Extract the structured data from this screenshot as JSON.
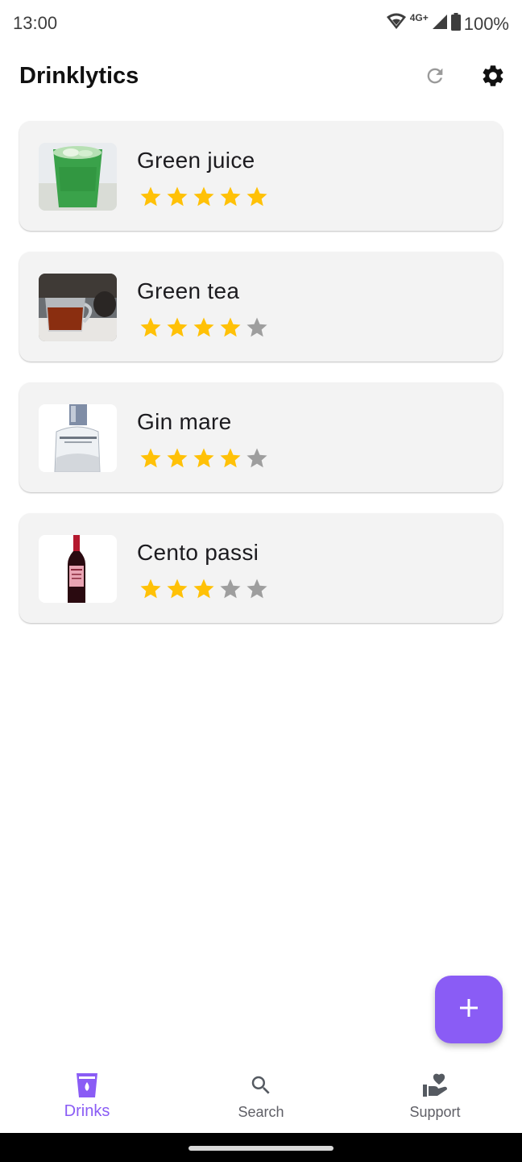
{
  "status_bar": {
    "time": "13:00",
    "network": "4G+",
    "battery": "100%"
  },
  "app_bar": {
    "title": "Drinklytics",
    "refresh_icon": "refresh-icon",
    "settings_icon": "gear-icon"
  },
  "drinks": [
    {
      "name": "Green juice",
      "rating": 5,
      "max_rating": 5,
      "image": "green-juice-glass"
    },
    {
      "name": "Green tea",
      "rating": 4,
      "max_rating": 5,
      "image": "tea-glass-cup"
    },
    {
      "name": "Gin mare",
      "rating": 4,
      "max_rating": 5,
      "image": "gin-bottle"
    },
    {
      "name": "Cento passi",
      "rating": 3,
      "max_rating": 5,
      "image": "wine-bottle"
    }
  ],
  "fab": {
    "icon": "plus-icon"
  },
  "bottom_nav": {
    "items": [
      {
        "label": "Drinks",
        "icon": "drink-glass-icon",
        "active": true
      },
      {
        "label": "Search",
        "icon": "search-icon",
        "active": false
      },
      {
        "label": "Support",
        "icon": "support-heart-hand-icon",
        "active": false
      }
    ]
  },
  "colors": {
    "accent": "#8a5cf5",
    "star_filled": "#ffc107",
    "star_empty": "#9e9e9e",
    "card_bg": "#f3f3f3"
  }
}
